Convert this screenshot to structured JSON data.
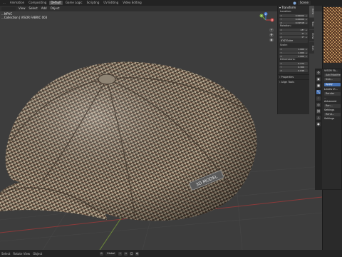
{
  "workspace_tabs": [
    "...",
    "Animation",
    "Compositing",
    "Default",
    "Game Logic",
    "Scripting",
    "UV Editing",
    "Video Editing"
  ],
  "active_tab_index": 3,
  "scene": {
    "label": "Scene",
    "icon": "scene-icon"
  },
  "viewport": {
    "header_buttons": [
      "View",
      "Select",
      "Add",
      "Object"
    ],
    "info_line1": "...MPVC",
    "info_line2": "...Collection | VISOR FABRIC 003",
    "hat_label": "3D MODEL",
    "gizmo_axes": [
      "X",
      "Y",
      "Z"
    ],
    "nav_icons": [
      "zoom-icon",
      "pan-icon",
      "camera-icon",
      "grid-icon"
    ]
  },
  "transform_panel": {
    "title": "Transform",
    "location_label": "Location:",
    "location": [
      {
        "axis": "X",
        "value": "0.00000"
      },
      {
        "axis": "Y",
        "value": "0.00000"
      },
      {
        "axis": "Z",
        "value": "0.01518"
      }
    ],
    "rotation_label": "Rotation:",
    "rotation": [
      {
        "axis": "X",
        "value": "15°"
      },
      {
        "axis": "Y",
        "value": "0°"
      },
      {
        "axis": "Z",
        "value": "0°"
      }
    ],
    "rotation_mode": "XYZ Euler",
    "scale_label": "Scale:",
    "scale": [
      {
        "axis": "X",
        "value": "1.000"
      },
      {
        "axis": "Y",
        "value": "1.000"
      },
      {
        "axis": "Z",
        "value": "1.000"
      }
    ],
    "dimensions_label": "Dimensions:",
    "dimensions": [
      {
        "axis": "X",
        "value": "0.274"
      },
      {
        "axis": "Y",
        "value": "0.309"
      },
      {
        "axis": "Z",
        "value": "0.048"
      }
    ],
    "properties_label": "Properties",
    "align_tools_label": "Align Tools"
  },
  "side_tabs": [
    "Item",
    "Tool",
    "View",
    "Edit"
  ],
  "properties_editor": {
    "title": "VISOR FA...",
    "add_modifier": "Add Modifier",
    "modifier_name": "Sub...",
    "apply_button": "Apply",
    "fields": [
      "Levels Vi...",
      "Render",
      "...",
      "Advanced",
      "Ren...",
      "Settings",
      "Rend...",
      "Settings"
    ]
  },
  "viewport_bottom": {
    "pivot": "Global",
    "icons": [
      "snap-icon",
      "magnet-icon",
      "proportional-icon",
      "overlay-icon"
    ]
  },
  "status_bar": [
    "Select",
    "Rotate View",
    "Object"
  ]
}
